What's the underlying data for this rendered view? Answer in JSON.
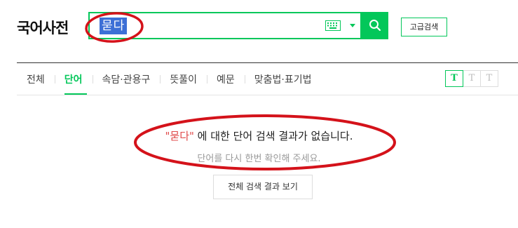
{
  "header": {
    "logo": "국어사전",
    "search_value": "묻다",
    "advanced_label": "고급검색"
  },
  "tabs": [
    {
      "label": "전체"
    },
    {
      "label": "단어"
    },
    {
      "label": "속담·관용구"
    },
    {
      "label": "뜻풀이"
    },
    {
      "label": "예문"
    },
    {
      "label": "맞춤법·표기법"
    }
  ],
  "font_sizes": [
    "T",
    "T",
    "T"
  ],
  "result": {
    "query": "\"묻다\"",
    "message_rest": " 에 대한 단어 검색 결과가 없습니다.",
    "sub": "단어를 다시 한번 확인해 주세요.",
    "all_results_label": "전체 검색 결과 보기"
  },
  "colors": {
    "accent": "#03c75a",
    "highlight": "#3d6fd6",
    "annotation": "#d4121a"
  }
}
